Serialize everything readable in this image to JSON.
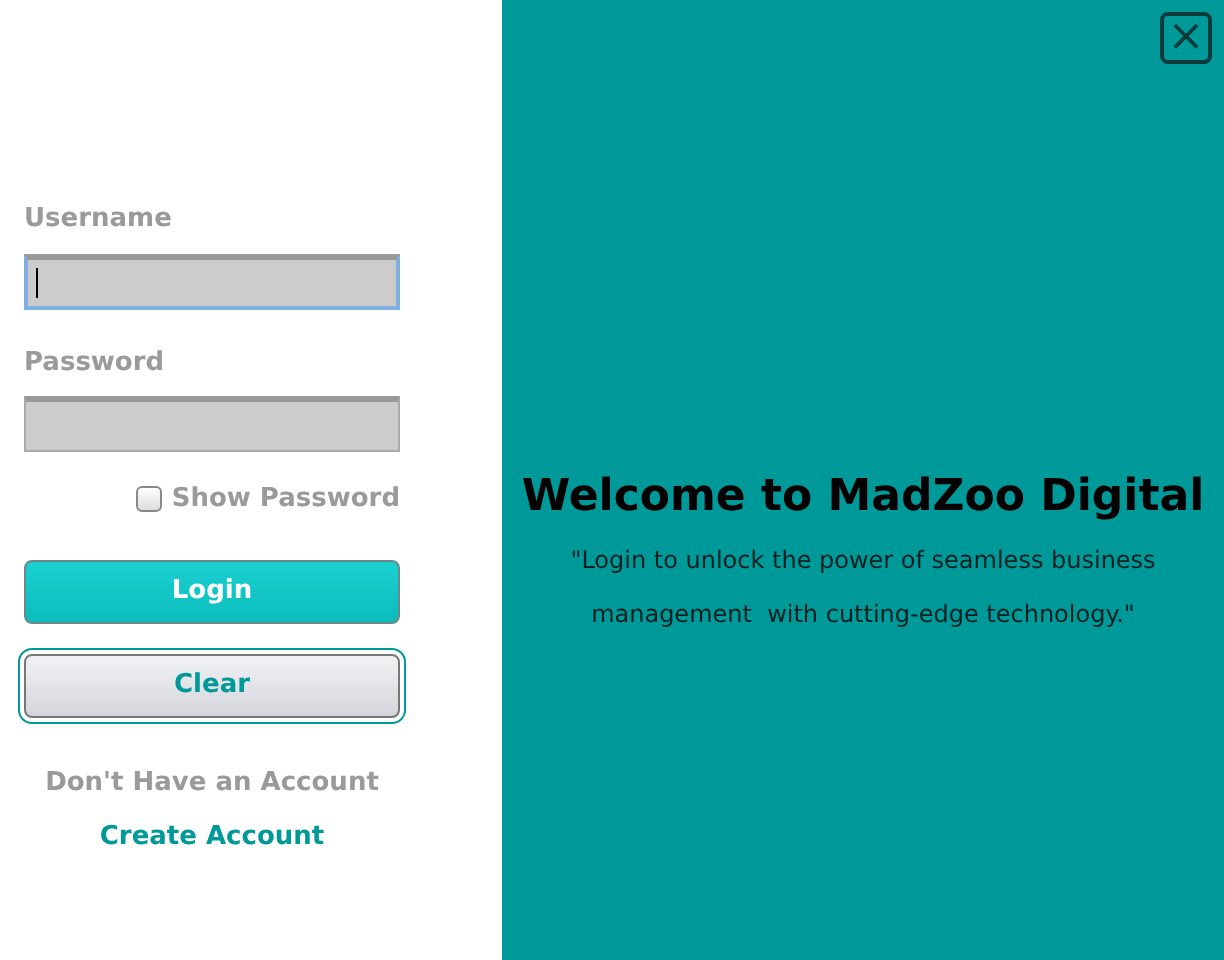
{
  "login_form": {
    "username": {
      "label": "Username",
      "focused": true
    },
    "password": {
      "label": "Password",
      "focused": false
    },
    "show_password": {
      "label": "Show Password",
      "checked": false
    },
    "buttons": [
      {
        "label": "Login",
        "kind": "primary"
      },
      {
        "label": "Clear",
        "kind": "secondary"
      }
    ],
    "account_prompt": "Don't Have an Account",
    "create_account_link": "Create Account"
  },
  "welcome_panel": {
    "close": "×",
    "title": "Welcome to MadZoo Digital",
    "tagline_lines": [
      "\"Login to unlock the power of seamless business",
      "management  with cutting-edge technology.\""
    ]
  }
}
